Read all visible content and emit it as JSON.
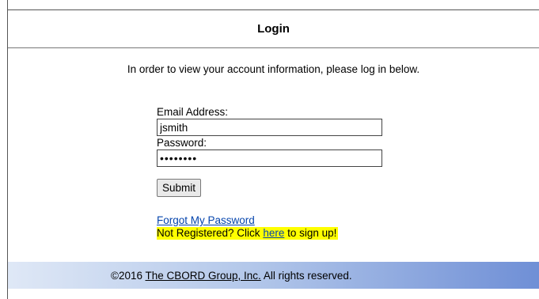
{
  "header": {
    "title": "Login"
  },
  "intro": {
    "text": "In order to view your account information, please log in below."
  },
  "form": {
    "email_label": "Email Address:",
    "email_value": "jsmith",
    "password_label": "Password:",
    "password_value": "••••••••",
    "submit_label": "Submit"
  },
  "links": {
    "forgot_password": "Forgot My Password",
    "not_registered_prefix": "Not Registered? Click ",
    "here": "here",
    "not_registered_suffix": " to sign up!"
  },
  "footer": {
    "copyright_prefix": "©2016 ",
    "company": "The CBORD Group, Inc.",
    "copyright_suffix": " All rights reserved."
  },
  "colors": {
    "highlight": "#ffff00",
    "link": "#0645ad",
    "footer_gradient_end": "#6f8fd6"
  }
}
